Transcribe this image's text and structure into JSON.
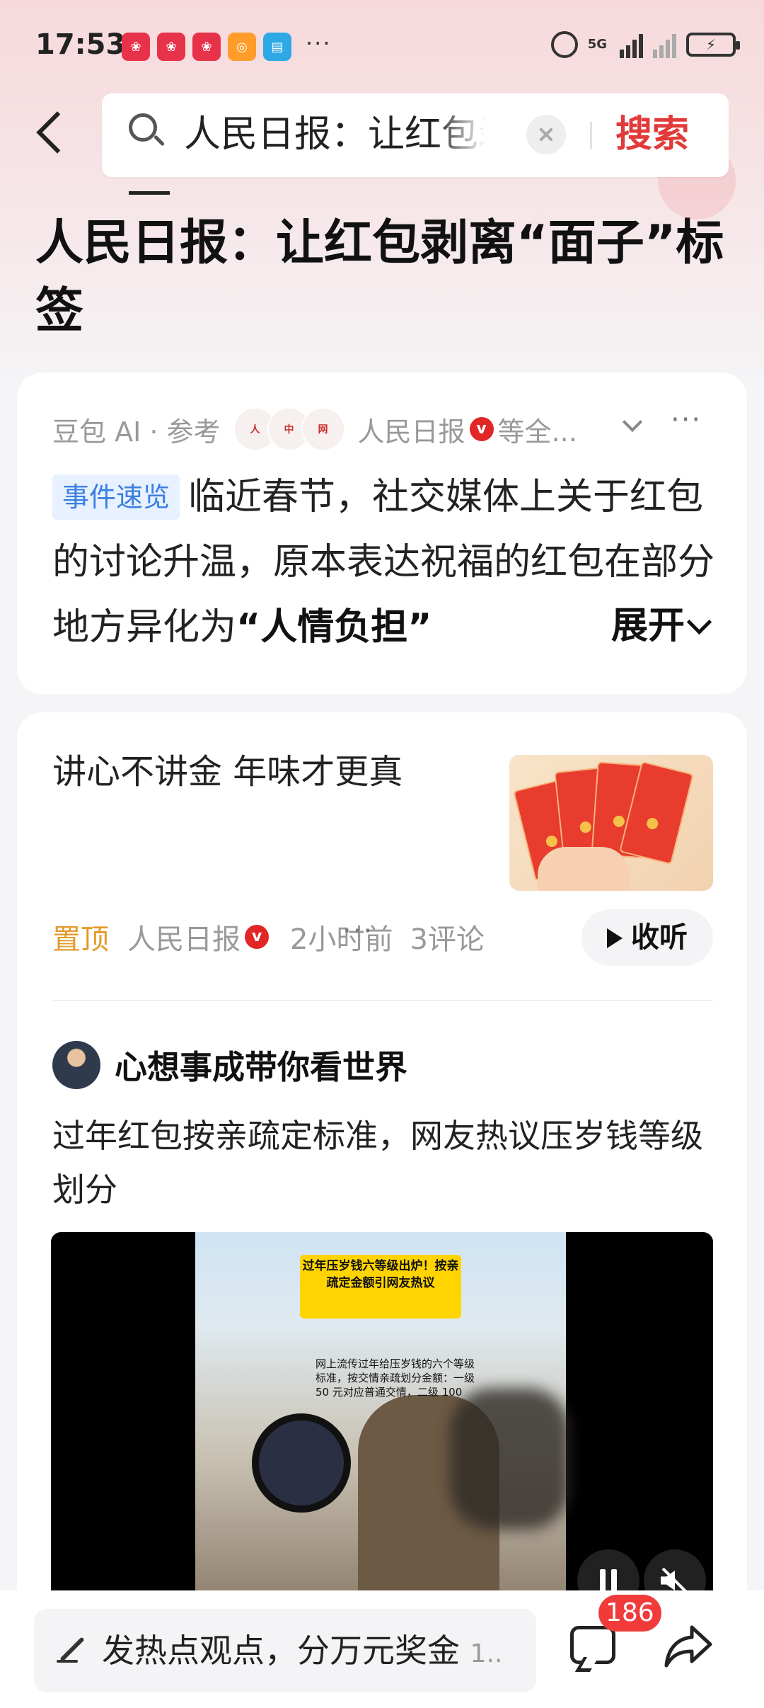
{
  "status_bar": {
    "time": "17:53",
    "network": "5G",
    "notification_icons": [
      "app-icon",
      "app-icon",
      "app-icon",
      "search-app-icon",
      "reader-app-icon"
    ],
    "more": "···"
  },
  "search": {
    "query": "人民日报：让红包剥",
    "button_label": "搜索"
  },
  "page": {
    "title": "人民日报：让红包剥离“面子”标签"
  },
  "ai_summary": {
    "source_label": "豆包 AI · 参考",
    "source_name": "人民日报",
    "verified": "v",
    "source_more": "等全...",
    "more": "···",
    "tag": "事件速览",
    "text": "临近春节，社交媒体上关于红包的讨论升温，原本表达祝福的红包在部分地方异化为",
    "highlight": "“人情负担”",
    "expand_label": "展开"
  },
  "article": {
    "title": "讲心不讲金 年味才更真",
    "pin_label": "置顶",
    "source": "人民日报",
    "verified": "v",
    "time": "2小时前",
    "comments": "3评论",
    "more": "···",
    "listen_label": "收听"
  },
  "post": {
    "author": "心想事成带你看世界",
    "text": "过年红包按亲疏定标准，网友热议压岁钱等级划分",
    "video_banner": "过年压岁钱六等级出炉！按亲疏定金额引网友热议",
    "video_caption": "网上流传过年给压岁钱的六个等级标准，按交情亲疏划分金额：一级 50 元对应普通交情，二级 100"
  },
  "bottom_bar": {
    "comment_placeholder": "发热点观点，分万元奖金",
    "comment_suffix": "1..",
    "comment_count": "186"
  },
  "colors": {
    "accent_red": "#e23a3a",
    "pin_orange": "#e39b2a",
    "tag_blue": "#3b7fe0"
  }
}
